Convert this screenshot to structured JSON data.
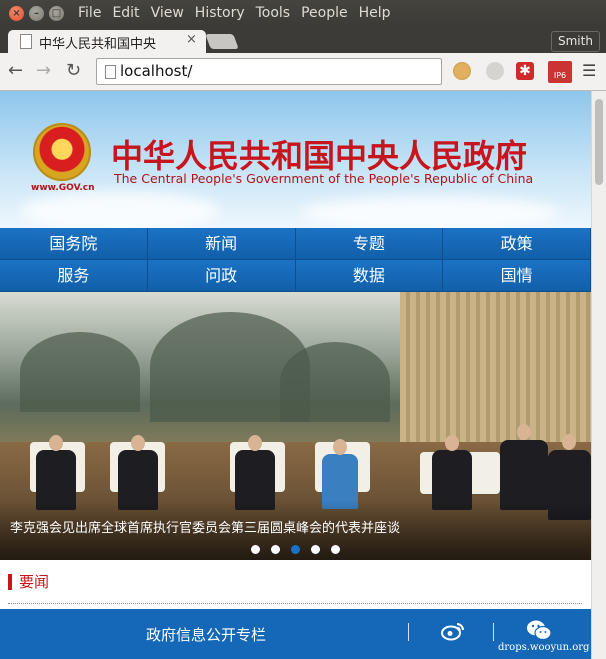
{
  "window": {
    "menu": [
      "File",
      "Edit",
      "View",
      "History",
      "Tools",
      "People",
      "Help"
    ],
    "profile_name": "Smith"
  },
  "tab": {
    "title": "中华人民共和国中央",
    "close_glyph": "×"
  },
  "toolbar": {
    "url": "localhost/",
    "ext_ip_label": "IP6",
    "ext_red_glyph": "✱"
  },
  "page": {
    "logo_url": "www.GOV.cn",
    "title": "中华人民共和国中央人民政府",
    "subtitle": "The Central People's Government of the People's Republic of China",
    "nav": [
      "国务院",
      "新闻",
      "专题",
      "政策",
      "服务",
      "问政",
      "数据",
      "国情"
    ],
    "hero_caption": "李克强会见出席全球首席执行官委员会第三届圆桌峰会的代表并座谈",
    "carousel": {
      "count": 5,
      "active_index": 2
    },
    "news_label": "要闻",
    "footer_link": "政府信息公开专栏",
    "watermark": "drops.wooyun.org"
  },
  "colors": {
    "gov_red": "#c8141c",
    "nav_blue": "#1568b8",
    "active_dot": "#1a72c6"
  }
}
